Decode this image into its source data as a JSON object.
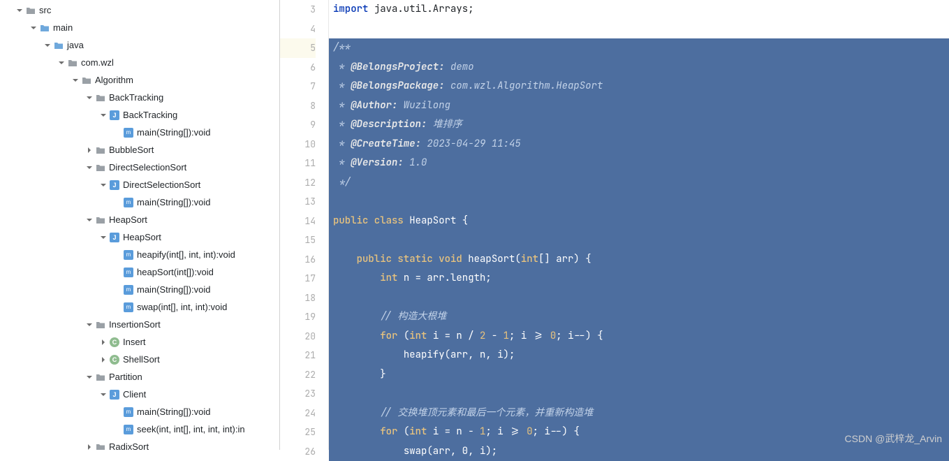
{
  "tree": [
    {
      "level": 1,
      "arrow": "down",
      "icon": "folder",
      "label": "src"
    },
    {
      "level": 2,
      "arrow": "down",
      "icon": "folder-blue",
      "label": "main"
    },
    {
      "level": 3,
      "arrow": "down",
      "icon": "folder-blue",
      "label": "java"
    },
    {
      "level": 4,
      "arrow": "down",
      "icon": "folder",
      "label": "com.wzl"
    },
    {
      "level": 5,
      "arrow": "down",
      "icon": "folder",
      "label": "Algorithm"
    },
    {
      "level": 6,
      "arrow": "down",
      "icon": "folder",
      "label": "BackTracking"
    },
    {
      "level": 7,
      "arrow": "down",
      "icon": "class",
      "label": "BackTracking"
    },
    {
      "level": 8,
      "arrow": "",
      "icon": "method",
      "label": "main(String[]):void"
    },
    {
      "level": 6,
      "arrow": "right",
      "icon": "folder",
      "label": "BubbleSort"
    },
    {
      "level": 6,
      "arrow": "down",
      "icon": "folder",
      "label": "DirectSelectionSort"
    },
    {
      "level": 7,
      "arrow": "down",
      "icon": "class",
      "label": "DirectSelectionSort"
    },
    {
      "level": 8,
      "arrow": "",
      "icon": "method",
      "label": "main(String[]):void"
    },
    {
      "level": 6,
      "arrow": "down",
      "icon": "folder",
      "label": "HeapSort"
    },
    {
      "level": 7,
      "arrow": "down",
      "icon": "class",
      "label": "HeapSort"
    },
    {
      "level": 8,
      "arrow": "",
      "icon": "method",
      "label": "heapify(int[], int, int):void"
    },
    {
      "level": 8,
      "arrow": "",
      "icon": "method",
      "label": "heapSort(int[]):void"
    },
    {
      "level": 8,
      "arrow": "",
      "icon": "method",
      "label": "main(String[]):void"
    },
    {
      "level": 8,
      "arrow": "",
      "icon": "method",
      "label": "swap(int[], int, int):void"
    },
    {
      "level": 6,
      "arrow": "down",
      "icon": "folder",
      "label": "InsertionSort"
    },
    {
      "level": 7,
      "arrow": "right",
      "icon": "circle",
      "label": "Insert"
    },
    {
      "level": 7,
      "arrow": "right",
      "icon": "circle",
      "label": "ShellSort"
    },
    {
      "level": 6,
      "arrow": "down",
      "icon": "folder",
      "label": "Partition"
    },
    {
      "level": 7,
      "arrow": "down",
      "icon": "class",
      "label": "Client"
    },
    {
      "level": 8,
      "arrow": "",
      "icon": "method",
      "label": "main(String[]):void"
    },
    {
      "level": 8,
      "arrow": "",
      "icon": "method",
      "label": "seek(int, int[], int, int, int):in"
    },
    {
      "level": 6,
      "arrow": "right",
      "icon": "folder",
      "label": "RadixSort"
    }
  ],
  "code": {
    "lines": [
      {
        "n": 3,
        "sel": false,
        "tokens": [
          {
            "t": "kw",
            "v": "import "
          },
          {
            "t": "",
            "v": "java.util.Arrays;"
          }
        ]
      },
      {
        "n": 4,
        "sel": false,
        "tokens": []
      },
      {
        "n": 5,
        "sel": true,
        "current": true,
        "tokens": [
          {
            "t": "cmt-s",
            "v": "/**"
          }
        ]
      },
      {
        "n": 6,
        "sel": true,
        "tokens": [
          {
            "t": "cmt-s",
            "v": " * "
          },
          {
            "t": "doc-tag",
            "v": "@BelongsProject:"
          },
          {
            "t": "cmt-s",
            "v": " demo"
          }
        ]
      },
      {
        "n": 7,
        "sel": true,
        "tokens": [
          {
            "t": "cmt-s",
            "v": " * "
          },
          {
            "t": "doc-tag",
            "v": "@BelongsPackage:"
          },
          {
            "t": "cmt-s",
            "v": " com.wzl.Algorithm.HeapSort"
          }
        ]
      },
      {
        "n": 8,
        "sel": true,
        "tokens": [
          {
            "t": "cmt-s",
            "v": " * "
          },
          {
            "t": "doc-tag",
            "v": "@Author:"
          },
          {
            "t": "cmt-s",
            "v": " Wuzilong"
          }
        ]
      },
      {
        "n": 9,
        "sel": true,
        "tokens": [
          {
            "t": "cmt-s",
            "v": " * "
          },
          {
            "t": "doc-tag",
            "v": "@Description:"
          },
          {
            "t": "cmt-s",
            "v": " 堆排序"
          }
        ]
      },
      {
        "n": 10,
        "sel": true,
        "tokens": [
          {
            "t": "cmt-s",
            "v": " * "
          },
          {
            "t": "doc-tag",
            "v": "@CreateTime:"
          },
          {
            "t": "cmt-s",
            "v": " 2023-04-29 11:45"
          }
        ]
      },
      {
        "n": 11,
        "sel": true,
        "tokens": [
          {
            "t": "cmt-s",
            "v": " * "
          },
          {
            "t": "doc-tag",
            "v": "@Version:"
          },
          {
            "t": "cmt-s",
            "v": " 1.0"
          }
        ]
      },
      {
        "n": 12,
        "sel": true,
        "tokens": [
          {
            "t": "cmt-s",
            "v": " */"
          }
        ]
      },
      {
        "n": 13,
        "sel": true,
        "tokens": []
      },
      {
        "n": 14,
        "sel": true,
        "tokens": [
          {
            "t": "kw-s",
            "v": "public class "
          },
          {
            "t": "ident",
            "v": "HeapSort {"
          }
        ]
      },
      {
        "n": 15,
        "sel": true,
        "tokens": []
      },
      {
        "n": 16,
        "sel": true,
        "tokens": [
          {
            "t": "",
            "v": "    "
          },
          {
            "t": "kw-s",
            "v": "public static void "
          },
          {
            "t": "ident",
            "v": "heapSort("
          },
          {
            "t": "kw-s",
            "v": "int"
          },
          {
            "t": "ident",
            "v": "[] arr) {"
          }
        ]
      },
      {
        "n": 17,
        "sel": true,
        "tokens": [
          {
            "t": "",
            "v": "        "
          },
          {
            "t": "kw-s",
            "v": "int "
          },
          {
            "t": "ident",
            "v": "n = arr.length;"
          }
        ]
      },
      {
        "n": 18,
        "sel": true,
        "tokens": []
      },
      {
        "n": 19,
        "sel": true,
        "tokens": [
          {
            "t": "",
            "v": "        "
          },
          {
            "t": "cmt-s",
            "v": "// 构造大根堆"
          }
        ]
      },
      {
        "n": 20,
        "sel": true,
        "tokens": [
          {
            "t": "",
            "v": "        "
          },
          {
            "t": "kw-s",
            "v": "for "
          },
          {
            "t": "ident",
            "v": "("
          },
          {
            "t": "kw-s",
            "v": "int "
          },
          {
            "t": "ident",
            "v": "i = n / "
          },
          {
            "t": "num",
            "v": "2"
          },
          {
            "t": "ident",
            "v": " - "
          },
          {
            "t": "num",
            "v": "1"
          },
          {
            "t": "ident",
            "v": "; i >= "
          },
          {
            "t": "num",
            "v": "0"
          },
          {
            "t": "ident",
            "v": "; i--) {"
          }
        ]
      },
      {
        "n": 21,
        "sel": true,
        "tokens": [
          {
            "t": "",
            "v": "            "
          },
          {
            "t": "ident",
            "v": "heapify(arr, n, i);"
          }
        ]
      },
      {
        "n": 22,
        "sel": true,
        "tokens": [
          {
            "t": "",
            "v": "        "
          },
          {
            "t": "ident",
            "v": "}"
          }
        ]
      },
      {
        "n": 23,
        "sel": true,
        "tokens": []
      },
      {
        "n": 24,
        "sel": true,
        "tokens": [
          {
            "t": "",
            "v": "        "
          },
          {
            "t": "cmt-s",
            "v": "// 交换堆顶元素和最后一个元素，并重新构造堆"
          }
        ]
      },
      {
        "n": 25,
        "sel": true,
        "tokens": [
          {
            "t": "",
            "v": "        "
          },
          {
            "t": "kw-s",
            "v": "for "
          },
          {
            "t": "ident",
            "v": "("
          },
          {
            "t": "kw-s",
            "v": "int "
          },
          {
            "t": "ident",
            "v": "i = n - "
          },
          {
            "t": "num",
            "v": "1"
          },
          {
            "t": "ident",
            "v": "; i >= "
          },
          {
            "t": "num",
            "v": "0"
          },
          {
            "t": "ident",
            "v": "; i--) {"
          }
        ]
      },
      {
        "n": 26,
        "sel": true,
        "tokens": [
          {
            "t": "",
            "v": "            "
          },
          {
            "t": "ident",
            "v": "swap(arr, 0, i);"
          }
        ]
      }
    ]
  },
  "watermark": "CSDN @武梓龙_Arvin"
}
